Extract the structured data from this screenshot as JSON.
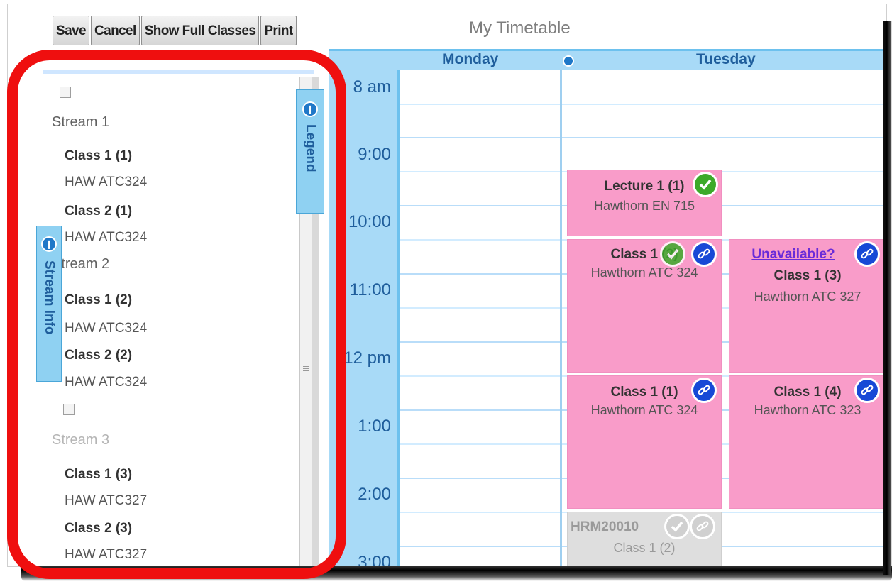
{
  "toolbar": {
    "save": "Save",
    "cancel": "Cancel",
    "show_full": "Show Full Classes",
    "print": "Print"
  },
  "title": "My Timetable",
  "tabs": {
    "legend": "Legend",
    "stream_info": "Stream Info"
  },
  "streams": [
    {
      "name": "Stream 1",
      "checked": false,
      "dimmed": false,
      "classes": [
        {
          "name": "Class 1 (1)",
          "room": "HAW ATC324"
        },
        {
          "name": "Class 2 (1)",
          "room": "HAW ATC324"
        }
      ]
    },
    {
      "name": "Stream 2",
      "dimmed": false,
      "classes": [
        {
          "name": "Class 1 (2)",
          "room": "HAW ATC324"
        },
        {
          "name": "Class 2 (2)",
          "room": "HAW ATC324"
        }
      ]
    },
    {
      "name": "Stream 3",
      "checked": false,
      "dimmed": true,
      "classes": [
        {
          "name": "Class 1 (3)",
          "room": "HAW ATC327"
        },
        {
          "name": "Class 2 (3)",
          "room": "HAW ATC327"
        }
      ]
    }
  ],
  "calendar": {
    "days": [
      "Monday",
      "Tuesday"
    ],
    "times": [
      "8 am",
      "9:00",
      "10:00",
      "11:00",
      "12 pm",
      "1:00",
      "2:00",
      "3:00"
    ],
    "events": [
      {
        "title": "Lecture 1 (1)",
        "room": "Hawthorn EN 715",
        "badge": "check"
      },
      {
        "title": "Class 1 (2)",
        "room": "Hawthorn ATC 324",
        "badges": [
          "check",
          "link"
        ]
      },
      {
        "link": "Unavailable?",
        "title": "Class 1 (3)",
        "room": "Hawthorn ATC 327",
        "badge": "link"
      },
      {
        "title": "Class 1 (1)",
        "room": "Hawthorn ATC 324",
        "badge": "link"
      },
      {
        "title": "Class 1 (4)",
        "room": "Hawthorn ATC 323",
        "badge": "link"
      },
      {
        "title": "HRM20010",
        "room": "Class 1 (2)",
        "badges": [
          "check",
          "link"
        ],
        "style": "grey"
      }
    ]
  },
  "colors": {
    "event_pink": "#f99cc9",
    "header_blue": "#a8daf7",
    "badge_green": "#3caa2a",
    "badge_blue": "#1749d6",
    "annotation_red": "#ef0f0f"
  }
}
